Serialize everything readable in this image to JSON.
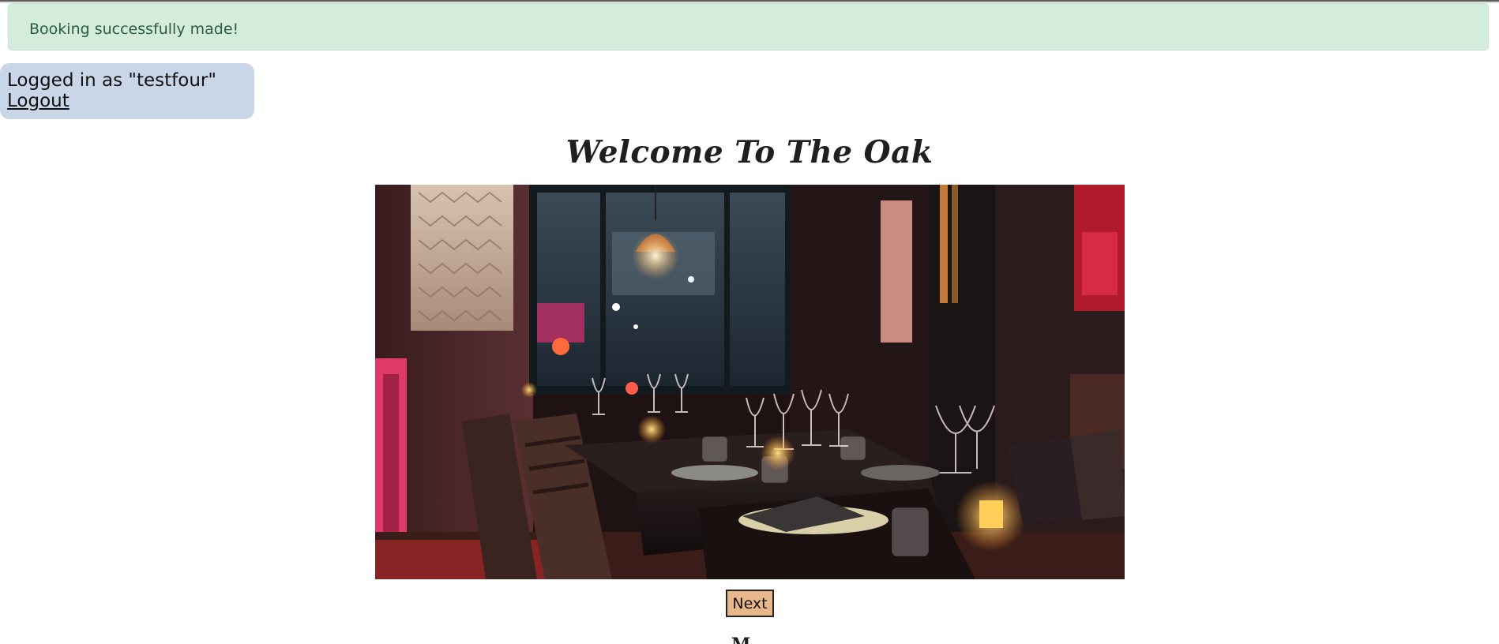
{
  "alert": {
    "message": "Booking successfully made!"
  },
  "login": {
    "prefix": "Logged in as \"testfour\"",
    "logout_label": " Logout"
  },
  "main": {
    "title": "Welcome To The Oak",
    "image_alt": "Restaurant dining room",
    "next_label": "Next"
  },
  "colors": {
    "alert_bg": "#d4ecdc",
    "alert_text": "#2b5d3b",
    "login_bg": "#c9d6e8",
    "next_bg": "#e8b88a"
  }
}
